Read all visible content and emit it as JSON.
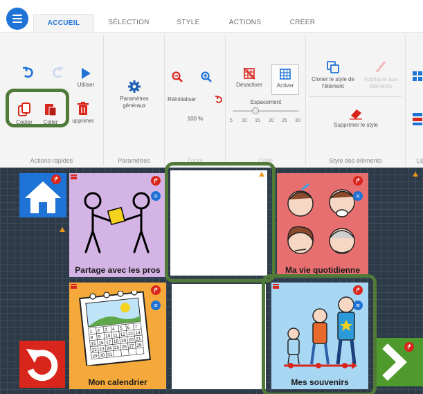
{
  "tabs": [
    {
      "label": "ACCUEIL",
      "active": true
    },
    {
      "label": "SÉLECTION",
      "active": false
    },
    {
      "label": "STYLE",
      "active": false
    },
    {
      "label": "ACTIONS",
      "active": false
    },
    {
      "label": "CRÉER",
      "active": false
    }
  ],
  "ribbon": {
    "quick_actions": {
      "utiliser": "Utiliser",
      "copier": "Copier",
      "coller": "Coller",
      "supprimer": "upprimer",
      "label": "Actions rapides"
    },
    "params": {
      "button": "Paramètres généraux",
      "label": "Paramètres"
    },
    "zoom": {
      "reset": "Réinitialiser",
      "value": "100 %",
      "label": "Zoom"
    },
    "grid": {
      "deactivate": "Désactiver",
      "activate": "Activer",
      "spacing": "Espacement",
      "ticks": [
        "5",
        "10",
        "15",
        "20",
        "25",
        "30"
      ],
      "label": "Grille"
    },
    "element_style": {
      "clone": "Cloner le style de l'élément",
      "apply": "Appliquer aux éléments",
      "delete": "Supprimer le style",
      "label": "Style des éléments"
    },
    "lines": {
      "label": "Lign"
    }
  },
  "board": {
    "cells": {
      "partage": "Partage avec les pros",
      "vie": "Ma vie quotidienne",
      "calendrier": "Mon calendrier",
      "souvenirs": "Mes souvenirs"
    },
    "calendar_numbers": [
      "1",
      "2",
      "3",
      "4",
      "5",
      "6",
      "7",
      "8",
      "9",
      "10",
      "11",
      "12",
      "13",
      "14",
      "15",
      "16",
      "17",
      "18",
      "19",
      "20",
      "21",
      "22",
      "23",
      "24",
      "25",
      "26",
      "27",
      "28",
      "29",
      "30",
      "31"
    ]
  },
  "colors": {
    "accent": "#1f73d6",
    "highlight": "#4f7a38",
    "purple": "#d3b4e4",
    "salmon": "#e76f6f",
    "orange": "#f6a93b",
    "light_blue": "#a8d7f3",
    "green": "#4e9a2c",
    "red": "#d9261c"
  }
}
